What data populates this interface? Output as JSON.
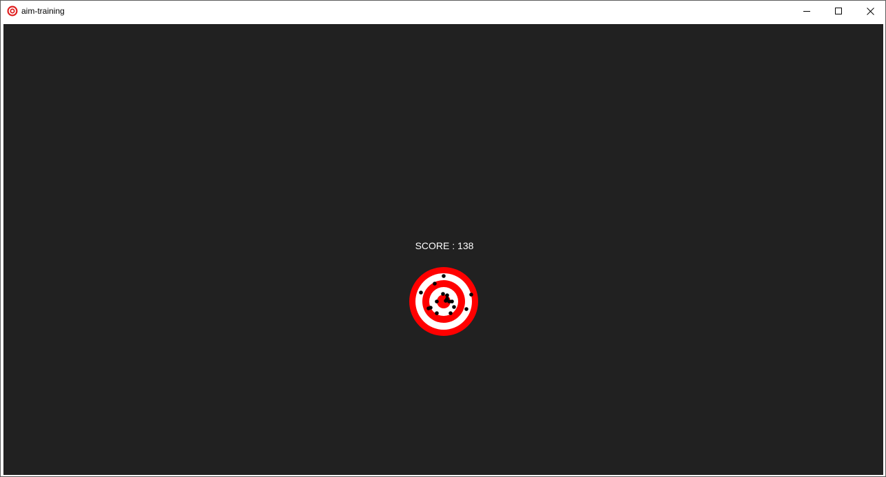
{
  "window": {
    "title": "aim-training",
    "app_icon": "target-icon",
    "controls": {
      "minimize": "minimize-icon",
      "maximize": "maximize-icon",
      "close": "close-icon"
    }
  },
  "game": {
    "background_color": "#212121",
    "score_label": "SCORE",
    "score_separator": " : ",
    "score_value": "138",
    "target": {
      "ring_colors": [
        "#ff0000",
        "#ffffff",
        "#ff0000",
        "#ffffff",
        "#ff0000"
      ],
      "hit_marker_color": "#000000",
      "hit_count": 17
    }
  }
}
